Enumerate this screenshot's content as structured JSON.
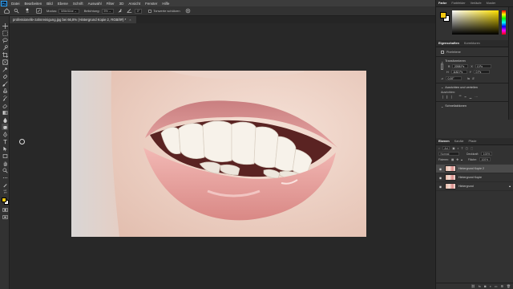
{
  "menubar": {
    "logo": "Ps",
    "items": [
      "Datei",
      "Bearbeiten",
      "Bild",
      "Ebene",
      "Schrift",
      "Auswahl",
      "Filter",
      "3D",
      "Ansicht",
      "Fenster",
      "Hilfe"
    ],
    "window_controls": [
      "–",
      "❐",
      "✕"
    ]
  },
  "options": {
    "brush_size": "19",
    "mode_label": "Modus:",
    "mode_value": "Mitteltöne",
    "exposure_label": "Belichtung:",
    "exposure_value": "5%",
    "angle_value": "0°",
    "protect_tones_label": "Tonwerte schützen"
  },
  "document": {
    "tab_title": "professionelle-zahnreinigung.jpg bei 66,8% (Hintergrund Kopie 2, RGB/8#) *",
    "close": "×"
  },
  "color_panel": {
    "tabs": [
      "Farbe",
      "Farbfelder",
      "Verläufe",
      "Muster"
    ],
    "foreground": "#f2c811",
    "background": "#ffffff"
  },
  "properties_panel": {
    "tabs": [
      "Eigenschaften",
      "Korrekturen"
    ],
    "layer_type": "Pixelebene",
    "transform_title": "Transformieren",
    "width_label": "B",
    "width_value": "2098 Px",
    "height_label": "H",
    "height_value": "1182 Px",
    "x_label": "X",
    "x_value": "0 Px",
    "y_label": "Y",
    "y_value": "0 Px",
    "angle_value": "0,00°",
    "align_title": "Ausrichten und verteilen",
    "align_sub": "Ausrichten:",
    "quick_actions_title": "Schnellaktionen"
  },
  "layers_panel": {
    "tabs": [
      "Ebenen",
      "Kanäle",
      "Pfade"
    ],
    "filter_label": "Art",
    "blend_mode": "Normal",
    "opacity_label": "Deckkraft:",
    "opacity_value": "100%",
    "lock_label": "Fixieren:",
    "fill_label": "Fläche:",
    "fill_value": "100%",
    "layers": [
      {
        "name": "Hintergrund Kopie 2",
        "selected": true
      },
      {
        "name": "Hintergrund Kopie",
        "selected": false
      },
      {
        "name": "Hintergrund",
        "selected": false
      }
    ],
    "footer_icons": [
      "link-icon",
      "fx-icon",
      "mask-icon",
      "adjustment-icon",
      "folder-icon",
      "new-layer-icon",
      "trash-icon"
    ]
  }
}
